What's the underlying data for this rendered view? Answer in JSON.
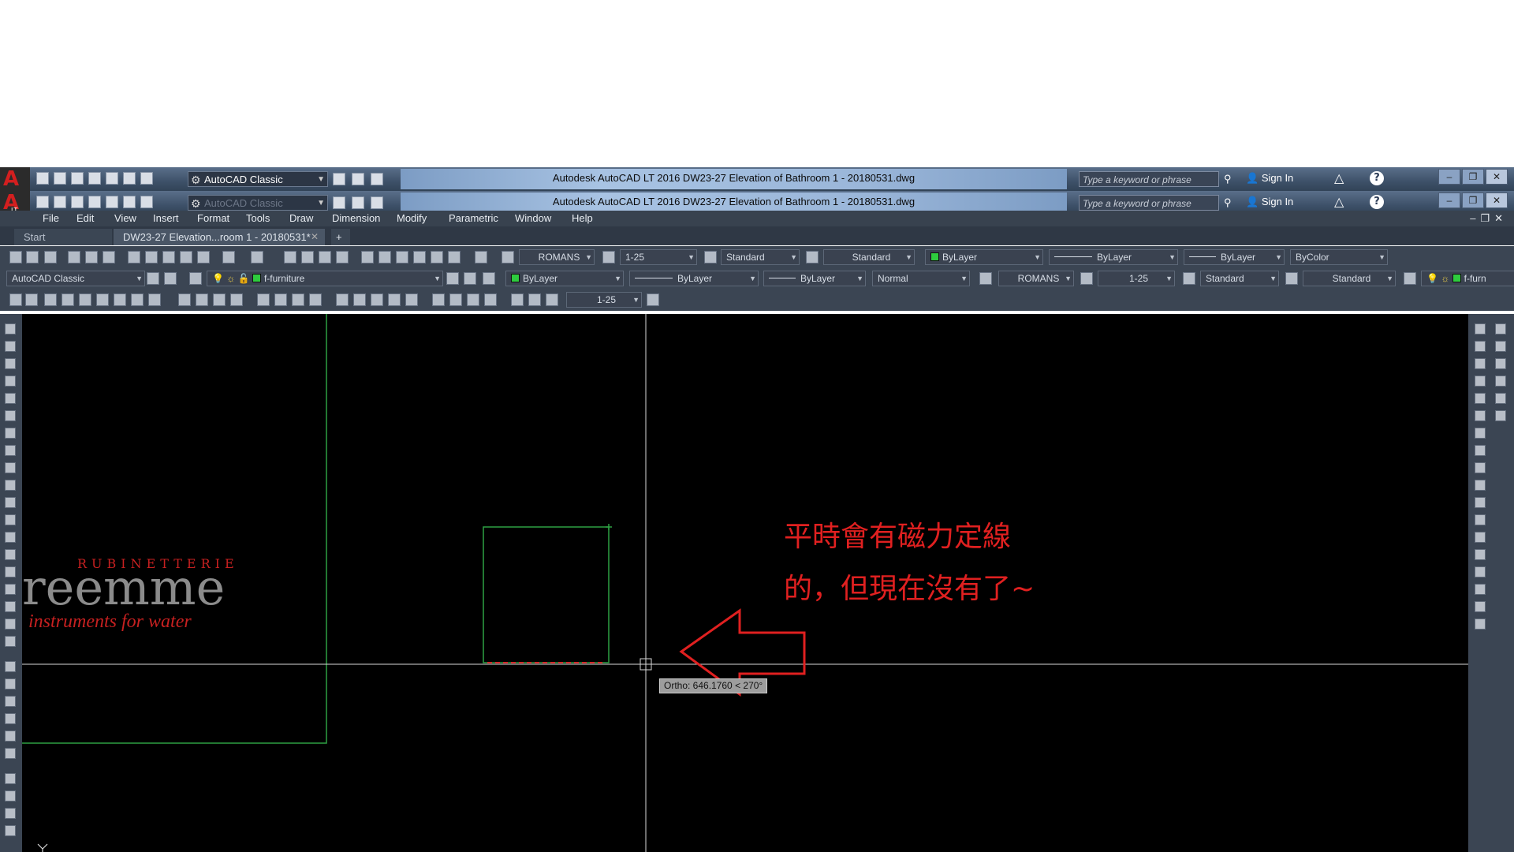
{
  "app": {
    "title": "Autodesk AutoCAD LT 2016    DW23-27 Elevation of Bathroom 1 - 20180531.dwg",
    "workspace": "AutoCAD Classic",
    "workspace_dim": "AutoCAD Classic",
    "search_placeholder": "Type a keyword or phrase",
    "sign_in": "Sign In",
    "help": "?",
    "logo_letter": "A",
    "logo_sub": "LT"
  },
  "menu": [
    "File",
    "Edit",
    "View",
    "Insert",
    "Format",
    "Tools",
    "Draw",
    "Dimension",
    "Modify",
    "Parametric",
    "Window",
    "Help"
  ],
  "tabs": {
    "start": "Start",
    "document": "DW23-27 Elevation...room 1 - 20180531*",
    "close": "✕",
    "new": "+"
  },
  "toolbar1": {
    "text_style": "ROMANS",
    "dim_style": "1-25",
    "table_style": "Standard",
    "mleader_style": "Standard",
    "color": "ByLayer",
    "linetype": "ByLayer",
    "lineweight": "ByLayer",
    "plot_style": "ByColor"
  },
  "toolbar2": {
    "workspace": "AutoCAD Classic",
    "layer": "f-furniture",
    "color": "ByLayer",
    "linetype": "ByLayer",
    "lineweight": "ByLayer",
    "plot_style": "Normal",
    "text_style": "ROMANS",
    "dim_style": "1-25",
    "table_style": "Standard",
    "mleader_style": "Standard",
    "layer_right": "f-furn"
  },
  "toolbar3": {
    "dim_style": "1-25"
  },
  "canvas": {
    "brand_top": "RUBINETTERIE",
    "brand_main": "reemme",
    "brand_sub": "instruments for water",
    "tooltip": "Ortho: 646.1760 < 270°",
    "annotation_line1": "平時會有磁力定線",
    "annotation_line2": "的，但現在沒有了~",
    "ucs": "Y"
  },
  "colors": {
    "accent_red": "#e02020",
    "geometry_green": "#2ea043",
    "crosshair": "#ffffff",
    "canvas_bg": "#000000"
  }
}
